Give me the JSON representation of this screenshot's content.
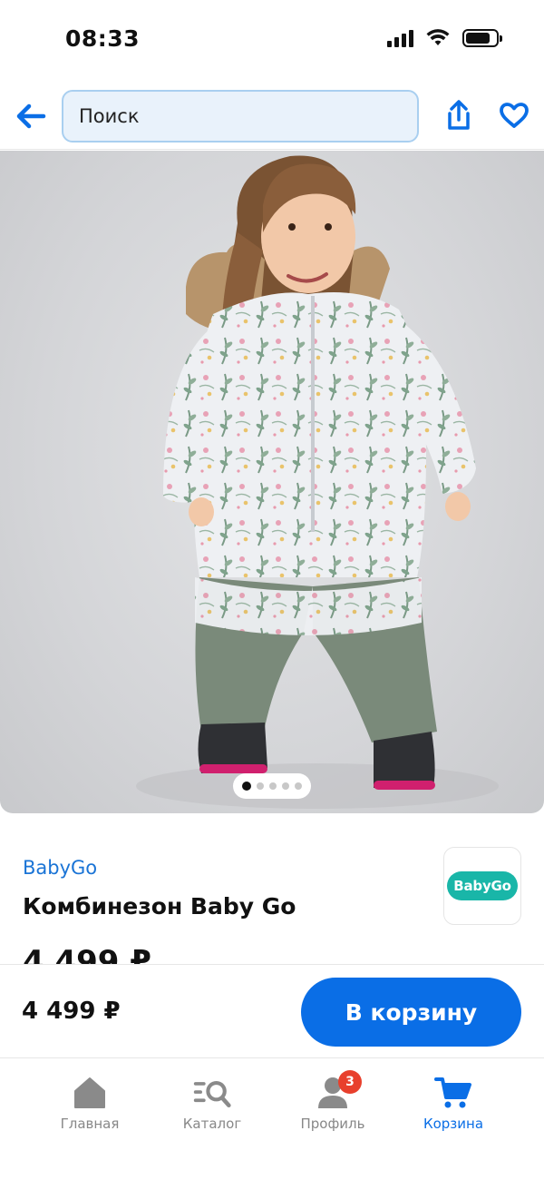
{
  "status_bar": {
    "time": "08:33",
    "battery_level": 0.8
  },
  "header": {
    "back_icon": "arrow-left-icon",
    "search_placeholder": "Поиск",
    "share_icon": "share-icon",
    "favorite_icon": "heart-icon"
  },
  "gallery": {
    "total_images": 5,
    "current_index": 1
  },
  "product": {
    "brand": "BabyGo",
    "title": "Комбинезон Baby Go",
    "price": "4 499 ₽",
    "brand_logo_text": "BabyGo"
  },
  "buy_bar": {
    "price": "4 499 ₽",
    "cart_button_label": "В корзину"
  },
  "tab_bar": {
    "items": [
      {
        "label": "Главная",
        "icon": "home-icon"
      },
      {
        "label": "Каталог",
        "icon": "catalog-search-icon"
      },
      {
        "label": "Профиль",
        "icon": "profile-icon",
        "badge": "3"
      },
      {
        "label": "Корзина",
        "icon": "cart-icon",
        "active": true
      }
    ]
  },
  "colors": {
    "accent": "#0a6ee6",
    "badge": "#e8402d",
    "logo": "#19b6a8",
    "search_bg": "#e9f2fb"
  }
}
